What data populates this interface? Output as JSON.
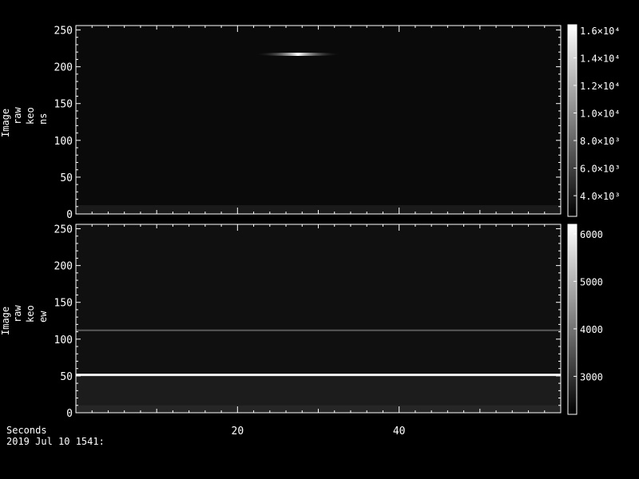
{
  "chart_data": [
    {
      "type": "heatmap",
      "title": "",
      "ylabel_lines": [
        "Image",
        "raw",
        "keo",
        "ns"
      ],
      "xlim": [
        0,
        60
      ],
      "ylim": [
        0,
        256
      ],
      "yticks": [
        0,
        50,
        100,
        150,
        200,
        250
      ],
      "ytick_labels": [
        "0",
        "50",
        "100",
        "150",
        "200",
        "250"
      ],
      "features": [
        {
          "kind": "bright-streak",
          "x_range": [
            22,
            33
          ],
          "y": 217,
          "peak": 16000
        }
      ],
      "colorbar": {
        "min": 2500,
        "max": 16400,
        "ticks": [
          4000,
          6000,
          8000,
          10000,
          12000,
          14000,
          16000
        ],
        "tick_labels": [
          "4.0×10³",
          "6.0×10³",
          "8.0×10³",
          "1.0×10⁴",
          "1.2×10⁴",
          "1.4×10⁴",
          "1.6×10⁴"
        ]
      }
    },
    {
      "type": "heatmap",
      "title": "",
      "ylabel_lines": [
        "Image",
        "raw",
        "keo",
        "ew"
      ],
      "xlim": [
        0,
        60
      ],
      "ylim": [
        0,
        256
      ],
      "yticks": [
        0,
        50,
        100,
        150,
        200,
        250
      ],
      "ytick_labels": [
        "0",
        "50",
        "100",
        "150",
        "200",
        "250"
      ],
      "xticks": [
        20,
        40
      ],
      "xtick_labels": [
        "20",
        "40"
      ],
      "features": [
        {
          "kind": "horizontal-line",
          "y": 52,
          "intensity": 6000
        },
        {
          "kind": "horizontal-line",
          "y": 112,
          "intensity": 3200
        }
      ],
      "colorbar": {
        "min": 2200,
        "max": 6200,
        "ticks": [
          3000,
          4000,
          5000,
          6000
        ],
        "tick_labels": [
          "3000",
          "4000",
          "5000",
          "6000"
        ]
      }
    }
  ],
  "footer": {
    "xlabel": "Seconds",
    "date": "2019 Jul 10 1541:"
  }
}
